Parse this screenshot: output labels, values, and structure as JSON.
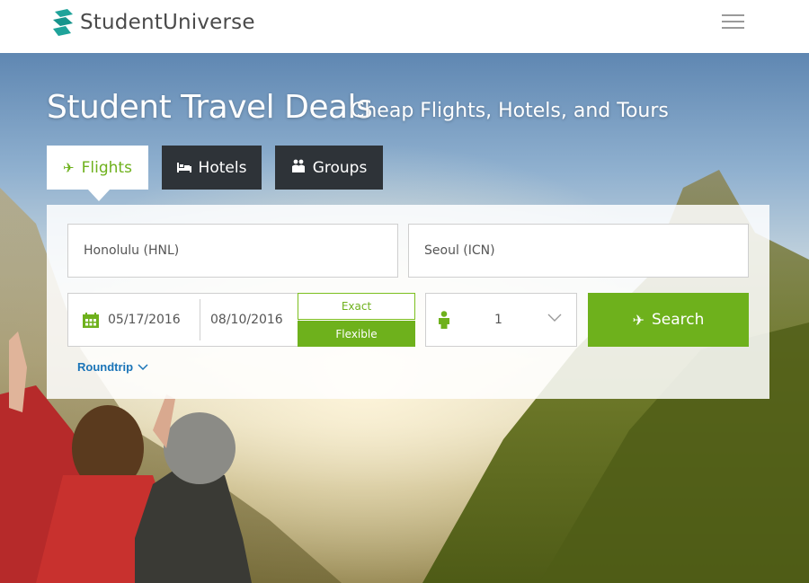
{
  "header": {
    "brand": "StudentUniverse",
    "logo_icon": "studentuniverse-logo-icon",
    "menu_icon": "hamburger-menu-icon"
  },
  "hero": {
    "title": "Student Travel Deals",
    "subtitle": "Cheap Flights, Hotels, and Tours"
  },
  "tabs": [
    {
      "label": "Flights",
      "icon": "airplane-icon",
      "active": true
    },
    {
      "label": "Hotels",
      "icon": "bed-icon",
      "active": false
    },
    {
      "label": "Groups",
      "icon": "group-icon",
      "active": false
    }
  ],
  "form": {
    "from_value": "Honolulu (HNL)",
    "to_value": "Seoul (ICN)",
    "depart_date": "05/17/2016",
    "return_date": "08/10/2016",
    "exact_label": "Exact",
    "flexible_label": "Flexible",
    "flexible_selected": true,
    "travelers": "1",
    "search_label": "Search",
    "trip_type": "Roundtrip"
  },
  "colors": {
    "accent_green": "#6eb11c",
    "tab_dark": "#2e3338",
    "link_blue": "#1a74b8",
    "logo_teal": "#1fa39a"
  }
}
